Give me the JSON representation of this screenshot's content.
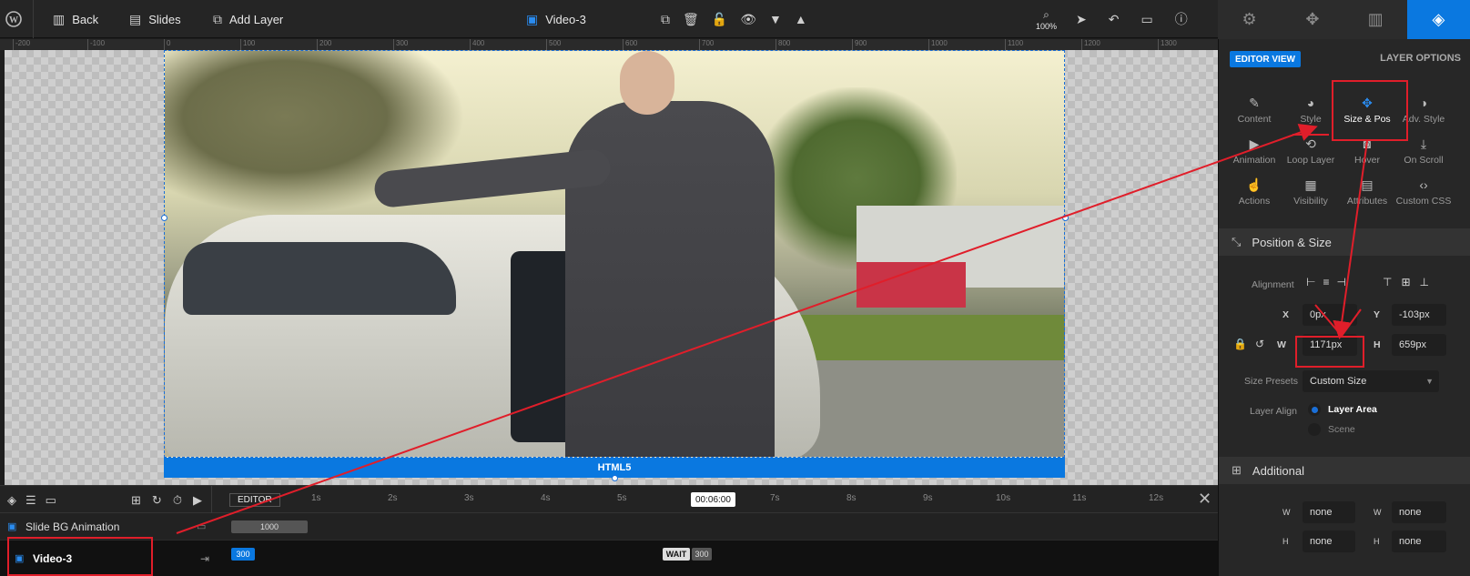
{
  "topbar": {
    "back": "Back",
    "slides": "Slides",
    "add_layer": "Add Layer",
    "layer_name": "Video-3",
    "zoom": "100%"
  },
  "ruler": {
    "ticks": [
      "-200",
      "-100",
      "0",
      "100",
      "200",
      "300",
      "400",
      "500",
      "600",
      "700",
      "800",
      "900",
      "1000",
      "1100",
      "1200",
      "1300"
    ]
  },
  "canvas": {
    "html5_label": "HTML5"
  },
  "panel": {
    "editor_view": "EDITOR VIEW",
    "layer_options": "LAYER OPTIONS",
    "options_row1": [
      {
        "label": "Content",
        "icon": "pencil-icon"
      },
      {
        "label": "Style",
        "icon": "palette-icon"
      },
      {
        "label": "Size & Pos",
        "icon": "move-icon"
      },
      {
        "label": "Adv. Style",
        "icon": "contrast-icon"
      }
    ],
    "options_row2": [
      {
        "label": "Animation",
        "icon": "play-icon"
      },
      {
        "label": "Loop Layer",
        "icon": "loop-icon"
      },
      {
        "label": "Hover",
        "icon": "mouse-icon"
      },
      {
        "label": "On Scroll",
        "icon": "scroll-icon"
      }
    ],
    "options_row3": [
      {
        "label": "Actions",
        "icon": "hand-icon"
      },
      {
        "label": "Visibility",
        "icon": "visibility-icon"
      },
      {
        "label": "Attributes",
        "icon": "document-icon"
      },
      {
        "label": "Custom CSS",
        "icon": "code-icon"
      }
    ],
    "position_size": {
      "title": "Position & Size",
      "alignment_label": "Alignment",
      "x_label": "X",
      "x_value": "0px",
      "y_label": "Y",
      "y_value": "-103px",
      "w_label": "W",
      "w_value": "1171px",
      "h_label": "H",
      "h_value": "659px",
      "size_presets_label": "Size Presets",
      "size_presets_value": "Custom Size",
      "layer_align_label": "Layer Align",
      "layer_align_options": [
        "Layer Area",
        "Scene"
      ]
    },
    "additional": {
      "title": "Additional",
      "min_w": "none",
      "max_w": "none",
      "min_h": "none",
      "max_h": "none",
      "w_label": "W",
      "h_label": "H"
    }
  },
  "timeline": {
    "editor_label": "EDITOR",
    "current_time": "00:06:00",
    "seconds": [
      "1s",
      "2s",
      "3s",
      "4s",
      "5s",
      "7s",
      "8s",
      "9s",
      "10s",
      "11s",
      "12s"
    ],
    "rows": [
      {
        "label": "Slide BG Animation",
        "value": "1000"
      },
      {
        "label": "Video-3",
        "value": "300",
        "wait": "WAIT",
        "wait_value": "300"
      }
    ]
  },
  "colors": {
    "accent": "#0a78e0",
    "highlight": "#e01e2a"
  }
}
